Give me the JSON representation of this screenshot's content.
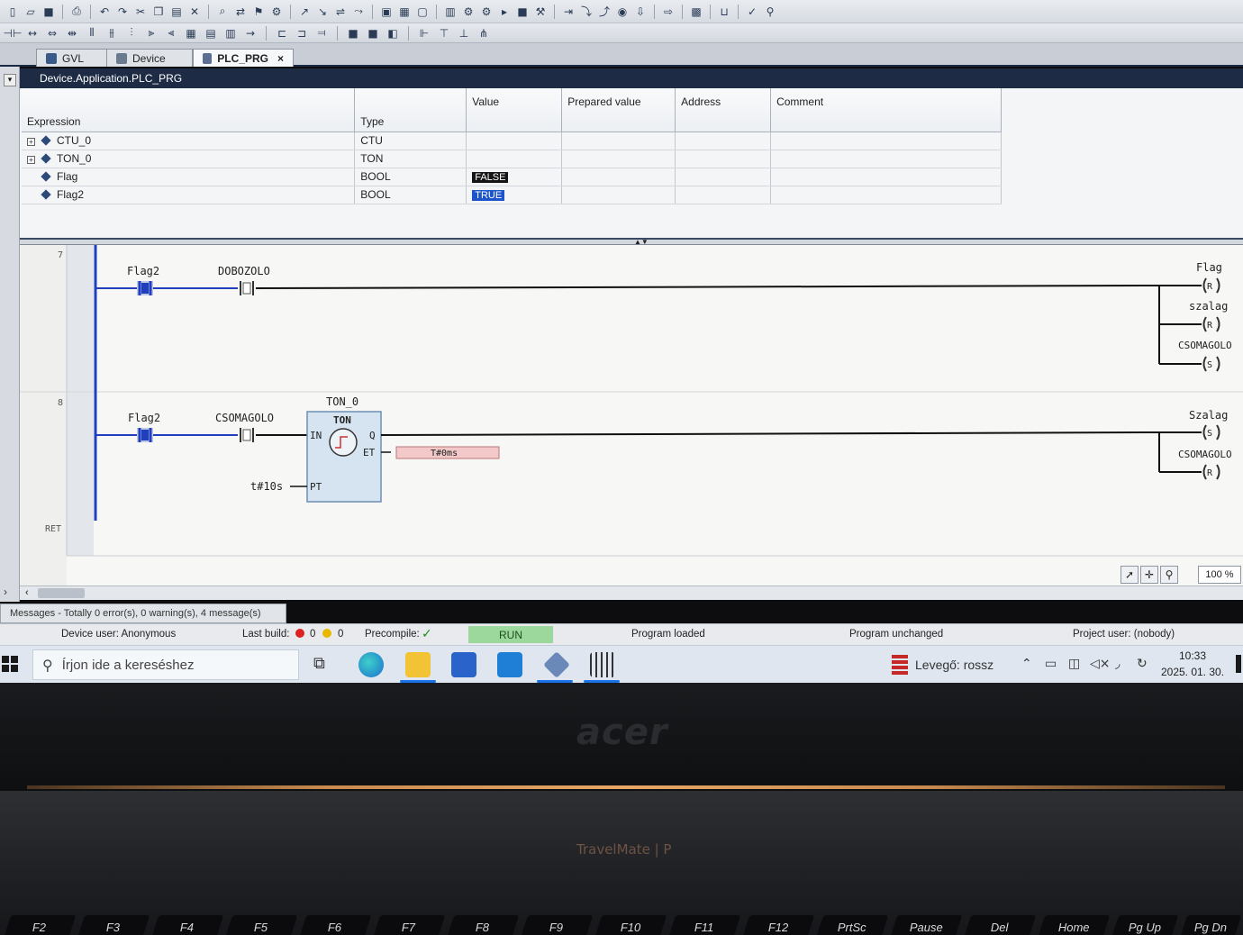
{
  "toolbar1": {
    "icons": [
      "new-file-icon",
      "open-icon",
      "save-icon",
      "print-icon",
      "undo-icon",
      "redo-icon",
      "cut-icon",
      "copy-icon",
      "paste-icon",
      "delete-icon",
      "find-icon",
      "find-replace-icon",
      "bookmark-icon",
      "build-icon",
      "login-icon",
      "logout-icon",
      "run-icon",
      "stop-icon",
      "reset-icon",
      "breakpoint-icon",
      "step-over-icon",
      "step-into-icon",
      "step-out-icon",
      "force-values-icon",
      "write-values-icon",
      "online-icon"
    ]
  },
  "toolbar2": {
    "icons": [
      "contact-icon",
      "coil-icon",
      "box-icon",
      "branch-icon",
      "jump-icon",
      "return-icon",
      "parallel-icon",
      "insert-icon"
    ]
  },
  "tabs": [
    {
      "label": "GVL"
    },
    {
      "label": "Device"
    },
    {
      "label": "PLC_PRG",
      "close": "×"
    }
  ],
  "breadcrumb": "Device.Application.PLC_PRG",
  "watch": {
    "headers": [
      "Expression",
      "Type",
      "Value",
      "Prepared value",
      "Address",
      "Comment"
    ],
    "rows": [
      {
        "expression": "CTU_0",
        "type": "CTU",
        "value": "",
        "expandable": true
      },
      {
        "expression": "TON_0",
        "type": "TON",
        "value": "",
        "expandable": true
      },
      {
        "expression": "Flag",
        "type": "BOOL",
        "value": "FALSE",
        "expandable": false
      },
      {
        "expression": "Flag2",
        "type": "BOOL",
        "value": "TRUE",
        "expandable": false
      }
    ]
  },
  "ladder": {
    "network7": {
      "number": "7",
      "contact1": "Flag2",
      "contact2": "DOBOZOLO",
      "coil1": "Flag",
      "coil1_type": "R",
      "coil2": "szalag",
      "coil2_type": "R",
      "coil3": "CSOMAGOLO",
      "coil3_type": "S"
    },
    "network8": {
      "number": "8",
      "contact1": "Flag2",
      "contact2": "CSOMAGOLO",
      "instance": "TON_0",
      "fb_type": "TON",
      "pin_in": "IN",
      "pin_q": "Q",
      "pin_et": "ET",
      "pin_pt": "PT",
      "pt_value": "t#10s",
      "et_value": "T#0ms",
      "coil1": "Szalag",
      "coil1_type": "S",
      "coil2": "CSOMAGOLO",
      "coil2_type": "R"
    },
    "ret_label": "RET"
  },
  "zoom": "100 %",
  "messages_tab": "Messages - Totally 0 error(s), 0 warning(s), 4 message(s)",
  "status": {
    "device_user": "Device user: Anonymous",
    "last_build_label": "Last build:",
    "errors": "0",
    "warnings": "0",
    "precompile_label": "Precompile:",
    "precompile_ok": "✓",
    "run": "RUN",
    "program_loaded": "Program loaded",
    "program_unchanged": "Program unchanged",
    "project_user": "Project user: (nobody)"
  },
  "taskbar": {
    "search_placeholder": "Írjon ide a kereséshez",
    "weather": "Levegő: rossz",
    "time": "10:33",
    "date": "2025. 01. 30."
  },
  "laptop": {
    "logo": "acer",
    "model": "TravelMate | P",
    "keys": [
      "F2",
      "F3",
      "F4",
      "F5",
      "F6",
      "F7",
      "F8",
      "F9",
      "F10",
      "F11",
      "F12",
      "PrtSc",
      "Pause",
      "Del",
      "Home",
      "Pg Up",
      "Pg Dn"
    ]
  }
}
